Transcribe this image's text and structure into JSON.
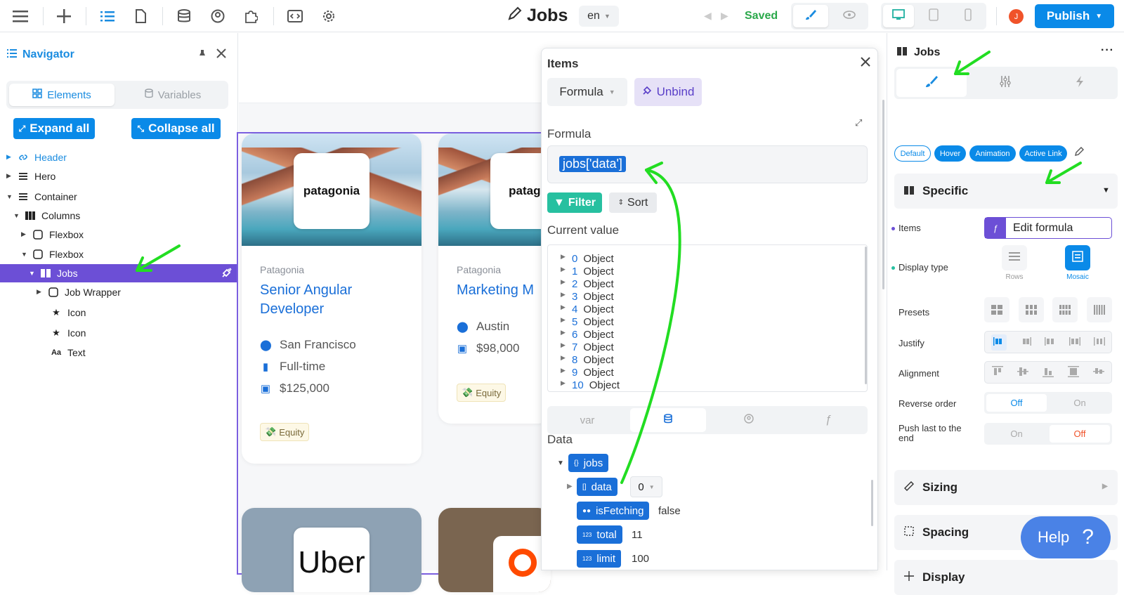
{
  "topbar": {
    "page_title": "Jobs",
    "lang": "en",
    "saved": "Saved",
    "publish": "Publish",
    "avatar": "J"
  },
  "navigator": {
    "title": "Navigator",
    "tabs": [
      "Elements",
      "Variables"
    ],
    "expand_all": "Expand all",
    "collapse_all": "Collapse all",
    "tree": [
      {
        "label": "Header",
        "icon": "link-icon"
      },
      {
        "label": "Hero",
        "icon": "section-icon"
      },
      {
        "label": "Container",
        "icon": "section-icon"
      },
      {
        "label": "Columns",
        "icon": "columns-icon"
      },
      {
        "label": "Flexbox",
        "icon": "box-icon"
      },
      {
        "label": "Flexbox",
        "icon": "box-icon"
      },
      {
        "label": "Jobs",
        "icon": "columns-icon"
      },
      {
        "label": "Job Wrapper",
        "icon": "box-icon"
      },
      {
        "label": "Icon",
        "icon": "star-icon"
      },
      {
        "label": "Icon",
        "icon": "star-icon"
      },
      {
        "label": "Text",
        "icon": "text-icon"
      }
    ]
  },
  "canvas": {
    "cards": [
      {
        "company": "Patagonia",
        "title": "Senior Angular Developer",
        "location": "San Francisco",
        "type": "Full-time",
        "salary": "$125,000",
        "tag": "Equity",
        "logo": "patagonia"
      },
      {
        "company": "Patagonia",
        "title": "Marketing M",
        "location": "Austin",
        "salary": "$98,000",
        "tag": "Equity",
        "logo": "patago"
      }
    ],
    "bottom_logos": [
      "Uber"
    ]
  },
  "popover": {
    "title": "Items",
    "mode": "Formula",
    "unbind": "Unbind",
    "formula_label": "Formula",
    "formula": "jobs['data']",
    "filter": "Filter",
    "sort": "Sort",
    "current_value_label": "Current value",
    "current_value": [
      {
        "k": "0",
        "v": "Object"
      },
      {
        "k": "1",
        "v": "Object"
      },
      {
        "k": "2",
        "v": "Object"
      },
      {
        "k": "3",
        "v": "Object"
      },
      {
        "k": "4",
        "v": "Object"
      },
      {
        "k": "5",
        "v": "Object"
      },
      {
        "k": "6",
        "v": "Object"
      },
      {
        "k": "7",
        "v": "Object"
      },
      {
        "k": "8",
        "v": "Object"
      },
      {
        "k": "9",
        "v": "Object"
      },
      {
        "k": "10",
        "v": "Object"
      }
    ],
    "source_tabs": [
      "var"
    ],
    "data_label": "Data",
    "data": {
      "root": "jobs",
      "data_key": "data",
      "data_index": "0",
      "is_fetching_key": "isFetching",
      "is_fetching_val": "false",
      "total_key": "total",
      "total_val": "11",
      "limit_key": "limit",
      "limit_val": "100"
    }
  },
  "right_panel": {
    "title": "Jobs",
    "states": [
      "Default",
      "Hover",
      "Animation",
      "Active Link"
    ],
    "specific": "Specific",
    "items_label": "Items",
    "edit_formula": "Edit formula",
    "display_type_label": "Display type",
    "display_rows": "Rows",
    "display_mosaic": "Mosaic",
    "presets_label": "Presets",
    "justify_label": "Justify",
    "alignment_label": "Alignment",
    "reverse_label": "Reverse order",
    "reverse_off": "Off",
    "reverse_on": "On",
    "push_label": "Push last to the end",
    "push_on": "On",
    "push_off": "Off",
    "sizing": "Sizing",
    "spacing": "Spacing",
    "display": "Display",
    "help": "Help"
  },
  "colors": {
    "accent": "#0a8ae8",
    "selection": "#6c4fd6",
    "saved": "#2aa84a",
    "annotation_arrow": "#22dd22"
  }
}
